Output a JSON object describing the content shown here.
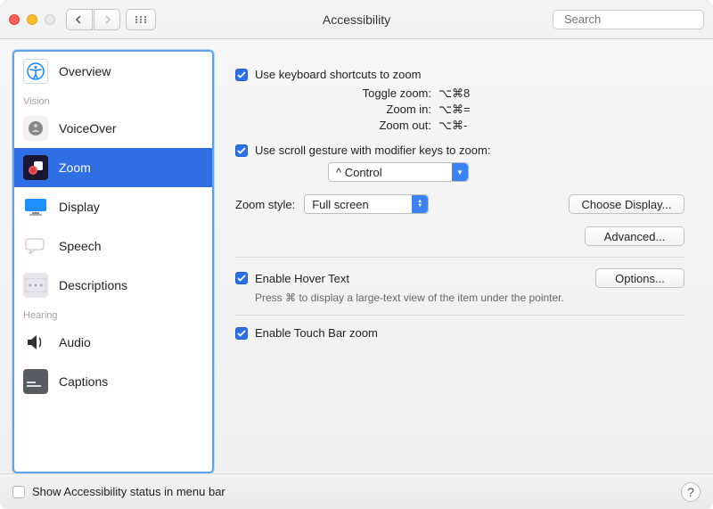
{
  "window": {
    "title": "Accessibility"
  },
  "toolbar": {
    "search_placeholder": "Search"
  },
  "sidebar": {
    "sections": {
      "vision": "Vision",
      "hearing": "Hearing"
    },
    "items": {
      "overview": "Overview",
      "voiceover": "VoiceOver",
      "zoom": "Zoom",
      "display": "Display",
      "speech": "Speech",
      "descriptions": "Descriptions",
      "audio": "Audio",
      "captions": "Captions"
    },
    "selected": "zoom"
  },
  "zoom": {
    "use_keyboard_label": "Use keyboard shortcuts to zoom",
    "use_keyboard_checked": true,
    "shortcuts": {
      "toggle_label": "Toggle zoom:",
      "toggle_value": "⌥⌘8",
      "in_label": "Zoom in:",
      "in_value": "⌥⌘=",
      "out_label": "Zoom out:",
      "out_value": "⌥⌘-"
    },
    "use_scroll_label": "Use scroll gesture with modifier keys to zoom:",
    "use_scroll_checked": true,
    "modifier_value": "^ Control",
    "zoom_style_label": "Zoom style:",
    "zoom_style_value": "Full screen",
    "choose_display_btn": "Choose Display...",
    "advanced_btn": "Advanced...",
    "hover_text_label": "Enable Hover Text",
    "hover_text_checked": true,
    "hover_options_btn": "Options...",
    "hover_hint": "Press ⌘ to display a large-text view of the item under the pointer.",
    "touchbar_label": "Enable Touch Bar zoom",
    "touchbar_checked": true
  },
  "footer": {
    "show_status_label": "Show Accessibility status in menu bar",
    "show_status_checked": false
  }
}
